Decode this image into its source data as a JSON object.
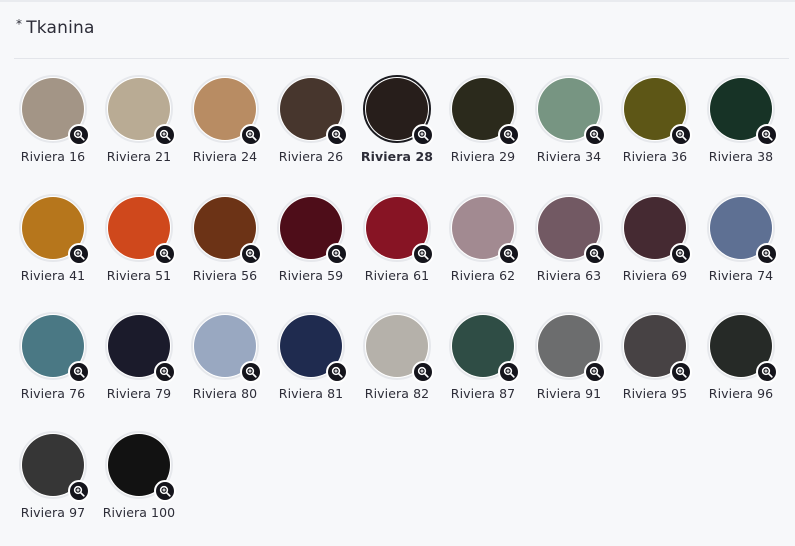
{
  "section": {
    "required_mark": "*",
    "title": "Tkanina"
  },
  "fabrics": [
    {
      "label": "Riviera 16",
      "color": "#a39586",
      "selected": false
    },
    {
      "label": "Riviera 21",
      "color": "#b9ab94",
      "selected": false
    },
    {
      "label": "Riviera 24",
      "color": "#b88c63",
      "selected": false
    },
    {
      "label": "Riviera 26",
      "color": "#47362d",
      "selected": false
    },
    {
      "label": "Riviera 28",
      "color": "#271e1b",
      "selected": true
    },
    {
      "label": "Riviera 29",
      "color": "#2b2a1c",
      "selected": false
    },
    {
      "label": "Riviera 34",
      "color": "#779582",
      "selected": false
    },
    {
      "label": "Riviera 36",
      "color": "#5d5616",
      "selected": false
    },
    {
      "label": "Riviera 38",
      "color": "#173326",
      "selected": false
    },
    {
      "label": "Riviera 41",
      "color": "#b6761c",
      "selected": false
    },
    {
      "label": "Riviera 51",
      "color": "#cf481c",
      "selected": false
    },
    {
      "label": "Riviera 56",
      "color": "#6c3316",
      "selected": false
    },
    {
      "label": "Riviera 59",
      "color": "#4e0d19",
      "selected": false
    },
    {
      "label": "Riviera 61",
      "color": "#871424",
      "selected": false
    },
    {
      "label": "Riviera 62",
      "color": "#a28a91",
      "selected": false
    },
    {
      "label": "Riviera 63",
      "color": "#725963",
      "selected": false
    },
    {
      "label": "Riviera 69",
      "color": "#452a32",
      "selected": false
    },
    {
      "label": "Riviera 74",
      "color": "#5e7093",
      "selected": false
    },
    {
      "label": "Riviera 76",
      "color": "#4a7884",
      "selected": false
    },
    {
      "label": "Riviera 79",
      "color": "#1b1b2b",
      "selected": false
    },
    {
      "label": "Riviera 80",
      "color": "#99a8c1",
      "selected": false
    },
    {
      "label": "Riviera 81",
      "color": "#1f2b4f",
      "selected": false
    },
    {
      "label": "Riviera 82",
      "color": "#b5b1aa",
      "selected": false
    },
    {
      "label": "Riviera 87",
      "color": "#2f4d45",
      "selected": false
    },
    {
      "label": "Riviera 91",
      "color": "#6c6d6e",
      "selected": false
    },
    {
      "label": "Riviera 95",
      "color": "#474244",
      "selected": false
    },
    {
      "label": "Riviera 96",
      "color": "#262a27",
      "selected": false
    },
    {
      "label": "Riviera 97",
      "color": "#363636",
      "selected": false
    },
    {
      "label": "Riviera 100",
      "color": "#121212",
      "selected": false
    }
  ],
  "zoom_icon": "magnifier-plus-icon"
}
